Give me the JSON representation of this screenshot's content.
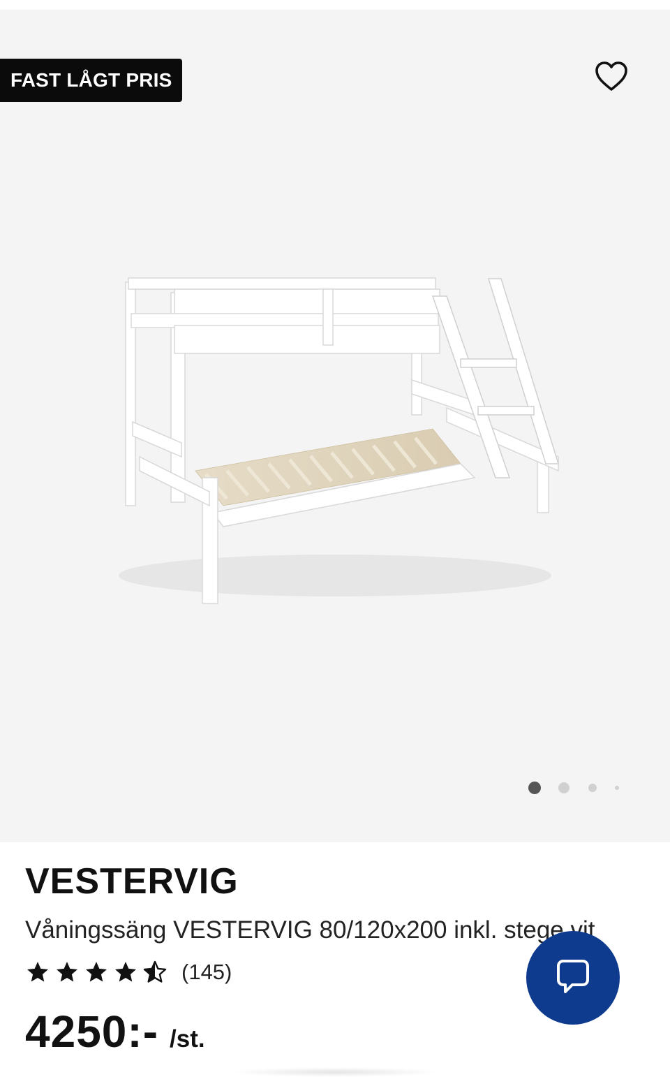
{
  "product": {
    "badge": "FAST LÅGT PRIS",
    "brand": "VESTERVIG",
    "description": "Våningssäng VESTERVIG 80/120x200 inkl. stege vit",
    "rating": {
      "stars_filled": 4,
      "stars_half": 1,
      "stars_total": 5,
      "count": "(145)"
    },
    "price": "4250:-",
    "price_unit": "/st."
  },
  "gallery": {
    "total_images": 4,
    "active_index": 0
  },
  "icons": {
    "favorite": "heart-outline-icon",
    "chat": "chat-bubble-icon"
  },
  "colors": {
    "badge_bg": "#0b0b0b",
    "chat_bg": "#0f3b8e",
    "gallery_bg": "#f4f4f4"
  }
}
